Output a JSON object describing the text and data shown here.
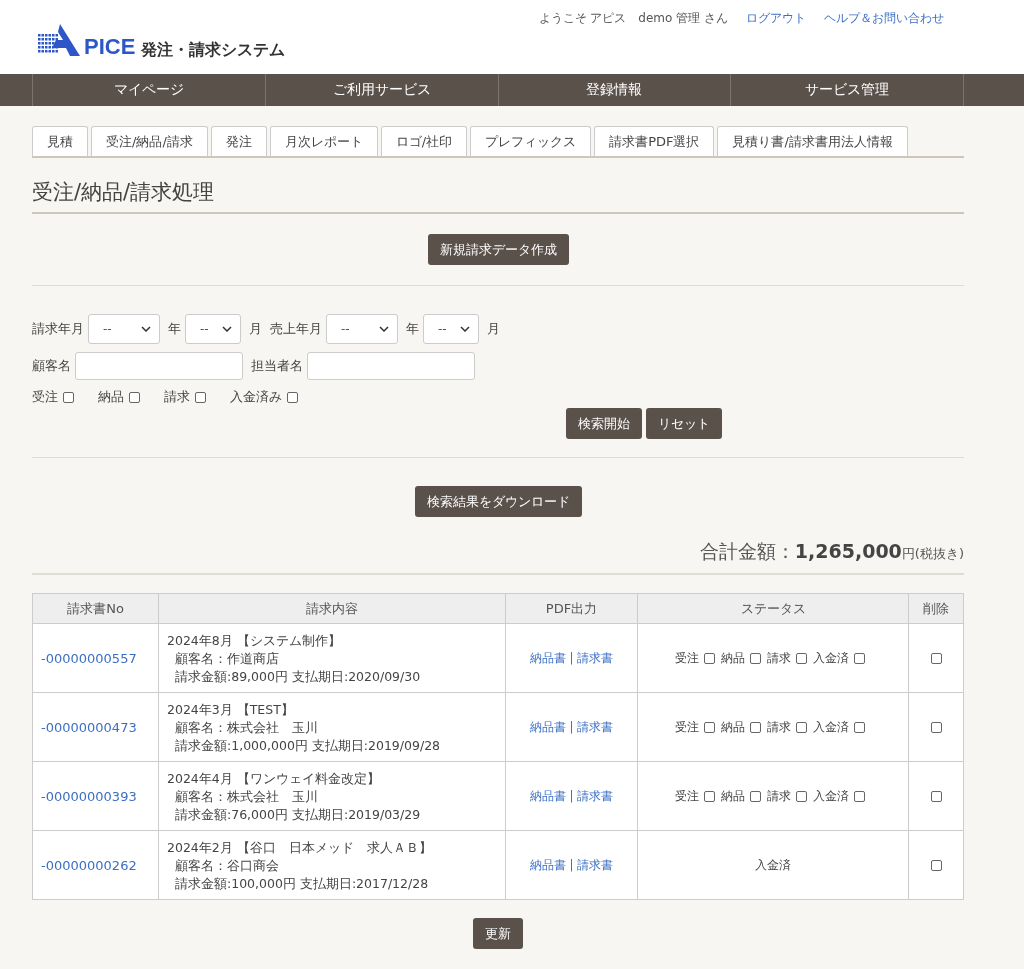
{
  "header": {
    "logo_text": "PICE",
    "system_name": "発注・請求システム",
    "welcome": "ようこそ アピス　demo 管理 さん",
    "links": [
      "ログアウト",
      "ヘルプ＆お問い合わせ"
    ]
  },
  "nav": [
    "マイページ",
    "ご利用サービス",
    "登録情報",
    "サービス管理"
  ],
  "tabs": [
    {
      "label": "見積",
      "selected": false
    },
    {
      "label": "受注/納品/請求",
      "selected": false
    },
    {
      "label": "発注",
      "selected": false
    },
    {
      "label": "月次レポート",
      "selected": false
    },
    {
      "label": "ロゴ/社印",
      "selected": false
    },
    {
      "label": "プレフィックス",
      "selected": false
    },
    {
      "label": "請求書PDF選択",
      "selected": false
    },
    {
      "label": "見積り書/請求書用法人情報",
      "selected": false
    }
  ],
  "page_title": "受注/納品/請求処理",
  "new_button": "新規請求データ作成",
  "filters": {
    "date_row": [
      {
        "kind": "label",
        "text": "請求年月"
      },
      {
        "kind": "year_select",
        "value": "--"
      },
      {
        "kind": "label",
        "text": "年"
      },
      {
        "kind": "month_select",
        "value": "--"
      },
      {
        "kind": "label",
        "text": "月"
      },
      {
        "kind": "label",
        "text": "売上年月"
      },
      {
        "kind": "year_select",
        "value": "--"
      },
      {
        "kind": "label",
        "text": "年"
      },
      {
        "kind": "month_select",
        "value": "--"
      },
      {
        "kind": "label",
        "text": "月"
      }
    ],
    "text_row": [
      {
        "kind": "label",
        "text": "顧客名"
      },
      {
        "kind": "input"
      },
      {
        "kind": "label",
        "text": "担当者名"
      },
      {
        "kind": "input"
      }
    ],
    "checks": [
      {
        "label": "受注",
        "checked": false
      },
      {
        "label": "納品",
        "checked": false
      },
      {
        "label": "請求",
        "checked": false
      },
      {
        "label": "入金済み",
        "checked": false
      }
    ],
    "buttons": [
      "検索開始",
      "リセット"
    ]
  },
  "download_button": "検索結果をダウンロード",
  "total": {
    "label": "合計金額：",
    "amount": "1,265,000",
    "unit": "円(税抜き)"
  },
  "table": {
    "columns": [
      "請求書No",
      "請求内容",
      "PDF出力",
      "ステータス",
      "削除"
    ],
    "rows": [
      {
        "no": "-00000000557",
        "lines": [
          "2024年8月 【システム制作】",
          "顧客名：作道商店",
          "請求金額:89,000円 支払期日:2020/09/30"
        ],
        "pdf_links": [
          "納品書",
          "請求書"
        ],
        "separator": "|",
        "status": {
          "kind": "checkboxes",
          "items": [
            {
              "label": "受注",
              "checked": false
            },
            {
              "label": "納品",
              "checked": false
            },
            {
              "label": "請求",
              "checked": false
            },
            {
              "label": "入金済",
              "checked": false
            }
          ]
        },
        "delete_checked": false
      },
      {
        "no": "-00000000473",
        "lines": [
          "2024年3月 【TEST】",
          "顧客名：株式会社　玉川",
          "請求金額:1,000,000円 支払期日:2019/09/28"
        ],
        "pdf_links": [
          "納品書",
          "請求書"
        ],
        "separator": "|",
        "status": {
          "kind": "checkboxes",
          "items": [
            {
              "label": "受注",
              "checked": false
            },
            {
              "label": "納品",
              "checked": false
            },
            {
              "label": "請求",
              "checked": false
            },
            {
              "label": "入金済",
              "checked": false
            }
          ]
        },
        "delete_checked": false
      },
      {
        "no": "-00000000393",
        "lines": [
          "2024年4月 【ワンウェイ料金改定】",
          "顧客名：株式会社　玉川",
          "請求金額:76,000円 支払期日:2019/03/29"
        ],
        "pdf_links": [
          "納品書",
          "請求書"
        ],
        "separator": "|",
        "status": {
          "kind": "checkboxes",
          "items": [
            {
              "label": "受注",
              "checked": false
            },
            {
              "label": "納品",
              "checked": false
            },
            {
              "label": "請求",
              "checked": false
            },
            {
              "label": "入金済",
              "checked": false
            }
          ]
        },
        "delete_checked": false
      },
      {
        "no": "-00000000262",
        "lines": [
          "2024年2月 【谷口　日本メッド　求人ＡＢ】",
          "顧客名：谷口商会",
          "請求金額:100,000円 支払期日:2017/12/28"
        ],
        "pdf_links": [
          "納品書",
          "請求書"
        ],
        "separator": "|",
        "status": {
          "kind": "text",
          "text": "入金済"
        },
        "delete_checked": false
      }
    ]
  },
  "update_button": "更新"
}
